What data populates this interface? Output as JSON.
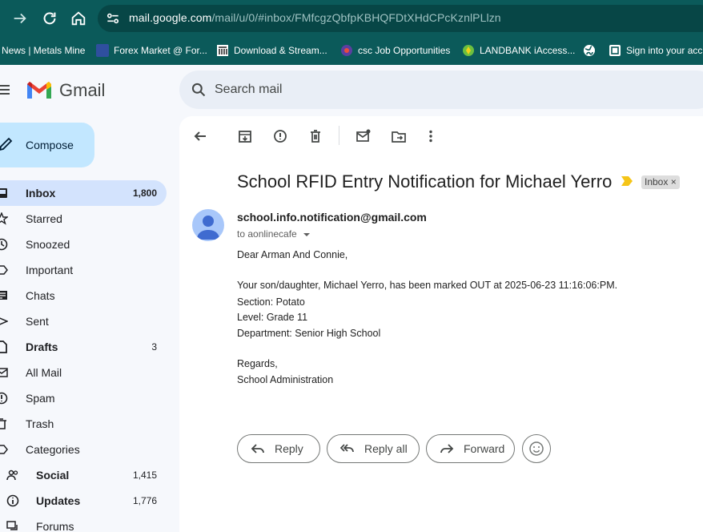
{
  "browser": {
    "url_host": "mail.google.com",
    "url_path": "/mail/u/0/#inbox/FMfcgzQbfpKBHQFDtXHdCPcKznlPLlzn",
    "bookmarks": [
      {
        "label": "News | Metals Mine",
        "icon": "none"
      },
      {
        "label": "Forex Market @ For...",
        "icon": "flag-icon"
      },
      {
        "label": "Download & Stream...",
        "icon": "building-icon"
      },
      {
        "label": "csc Job Opportunities",
        "icon": "csc-logo-icon"
      },
      {
        "label": "LANDBANK iAccess...",
        "icon": "landbank-icon"
      },
      {
        "label": "",
        "icon": "globe-icon"
      },
      {
        "label": "Sign into your acc",
        "icon": "outlook-icon"
      }
    ]
  },
  "gmail": {
    "logo_text": "Gmail",
    "search_placeholder": "Search mail",
    "compose_label": "Compose",
    "nav": [
      {
        "label": "Inbox",
        "count": "1,800",
        "icon": "inbox-icon",
        "bold": true,
        "selected": true
      },
      {
        "label": "Starred",
        "count": "",
        "icon": "star-icon"
      },
      {
        "label": "Snoozed",
        "count": "",
        "icon": "clock-icon"
      },
      {
        "label": "Important",
        "count": "",
        "icon": "important-icon"
      },
      {
        "label": "Chats",
        "count": "",
        "icon": "chat-icon"
      },
      {
        "label": "Sent",
        "count": "",
        "icon": "send-icon"
      },
      {
        "label": "Drafts",
        "count": "3",
        "icon": "draft-icon",
        "bold": true
      },
      {
        "label": "All Mail",
        "count": "",
        "icon": "mail-icon"
      },
      {
        "label": "Spam",
        "count": "",
        "icon": "spam-icon"
      },
      {
        "label": "Trash",
        "count": "",
        "icon": "trash-icon"
      },
      {
        "label": "Categories",
        "count": "",
        "icon": "label-icon"
      },
      {
        "label": "Social",
        "count": "1,415",
        "icon": "people-icon",
        "bold": true,
        "sub": true
      },
      {
        "label": "Updates",
        "count": "1,776",
        "icon": "info-icon",
        "bold": true,
        "sub": true
      },
      {
        "label": "Forums",
        "count": "",
        "icon": "forum-icon",
        "sub": true
      }
    ]
  },
  "message": {
    "subject": "School RFID Entry Notification for Michael Yerro",
    "label": "Inbox",
    "label_close": "×",
    "sender": "school.info.notification@gmail.com",
    "to": "to aonlinecafe",
    "body": [
      "Dear Arman And Connie,",
      "",
      "Your son/daughter, Michael Yerro, has been marked OUT at 2025-06-23 11:16:06:PM.",
      "Section: Potato",
      "Level: Grade 11",
      "Department: Senior High School",
      "",
      "Regards,",
      "School Administration"
    ],
    "actions": {
      "reply": "Reply",
      "reply_all": "Reply all",
      "forward": "Forward"
    }
  }
}
